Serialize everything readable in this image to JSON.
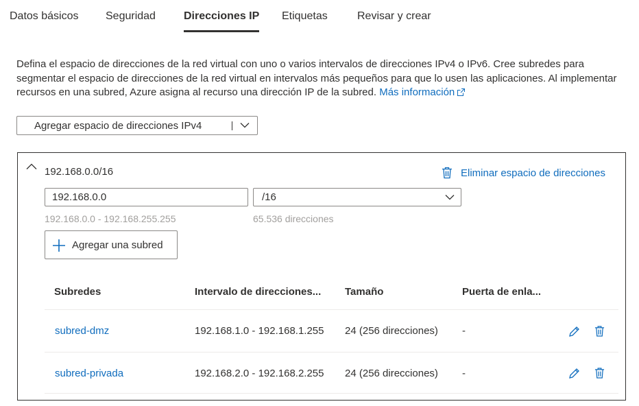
{
  "tabs": [
    {
      "label": "Datos básicos",
      "active": false
    },
    {
      "label": "Seguridad",
      "active": false
    },
    {
      "label": "Direcciones IP",
      "active": true
    },
    {
      "label": "Etiquetas",
      "active": false
    },
    {
      "label": "Revisar y crear",
      "active": false
    }
  ],
  "description": {
    "text": "Defina el espacio de direcciones de la red virtual con uno o varios intervalos de direcciones IPv4 o IPv6. Cree subredes para segmentar el espacio de direcciones de la red virtual en intervalos más pequeños para que lo usen las aplicaciones. Al implementar recursos en una subred, Azure asigna al recurso una dirección IP de la subred.",
    "link": "Más información"
  },
  "add_space_dropdown": {
    "label": "Agregar espacio de direcciones IPv4"
  },
  "address_space": {
    "title": "192.168.0.0/16",
    "delete_label": "Eliminar espacio de direcciones",
    "ip_value": "192.168.0.0",
    "prefix_value": "/16",
    "range_hint": "192.168.0.0 - 192.168.255.255",
    "count_hint": "65.536 direcciones",
    "add_subnet_label": "Agregar una subred"
  },
  "subnet_table": {
    "headers": [
      "Subredes",
      "Intervalo de direcciones...",
      "Tamaño",
      "Puerta de enla..."
    ],
    "rows": [
      {
        "name": "subred-dmz",
        "range": "192.168.1.0 - 192.168.1.255",
        "size": "24 (256 direcciones)",
        "gateway": "-"
      },
      {
        "name": "subred-privada",
        "range": "192.168.2.0 - 192.168.2.255",
        "size": "24 (256 direcciones)",
        "gateway": "-"
      }
    ]
  },
  "colors": {
    "accent": "#0f6cbd",
    "text": "#323130",
    "hint": "#a19f9d",
    "border": "#8a8886"
  },
  "icons": {
    "collapse": "chevron-up-icon",
    "delete": "trash-icon",
    "edit": "pencil-icon",
    "add": "plus-icon",
    "external": "external-link-icon",
    "dropdown": "chevron-down-icon"
  }
}
